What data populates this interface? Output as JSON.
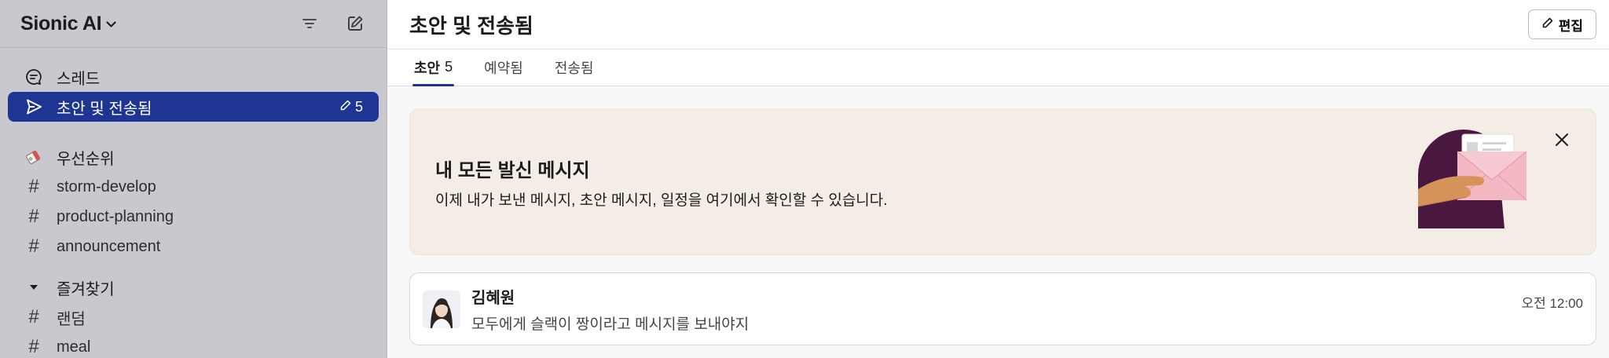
{
  "workspace": {
    "name": "Sionic AI"
  },
  "sidebar": {
    "nav": [
      {
        "label": "스레드",
        "icon": "threads-icon"
      },
      {
        "label": "초안 및 전송됨",
        "icon": "send-icon",
        "badge": "5",
        "active": true
      }
    ],
    "priority": {
      "label": "우선순위",
      "icon": "tag-icon"
    },
    "channels": [
      "storm-develop",
      "product-planning",
      "announcement"
    ],
    "favorites": {
      "label": "즐겨찾기",
      "channels": [
        "랜덤",
        "meal"
      ]
    }
  },
  "header": {
    "title": "초안 및 전송됨",
    "edit_label": "편집"
  },
  "tabs": [
    {
      "label": "초안",
      "count": "5",
      "active": true
    },
    {
      "label": "예약됨"
    },
    {
      "label": "전송됨"
    }
  ],
  "banner": {
    "title": "내 모든 발신 메시지",
    "description": "이제 내가 보낸 메시지, 초안 메시지, 일정을 여기에서 확인할 수 있습니다."
  },
  "draft": {
    "author": "김혜원",
    "text": "모두에게 슬랙이 짱이라고 메시지를 보내야지",
    "time": "오전 12:00"
  },
  "colors": {
    "accent": "#1f3594",
    "sidebar_bg": "#c9c8cf",
    "banner_bg": "#f4ede6"
  }
}
